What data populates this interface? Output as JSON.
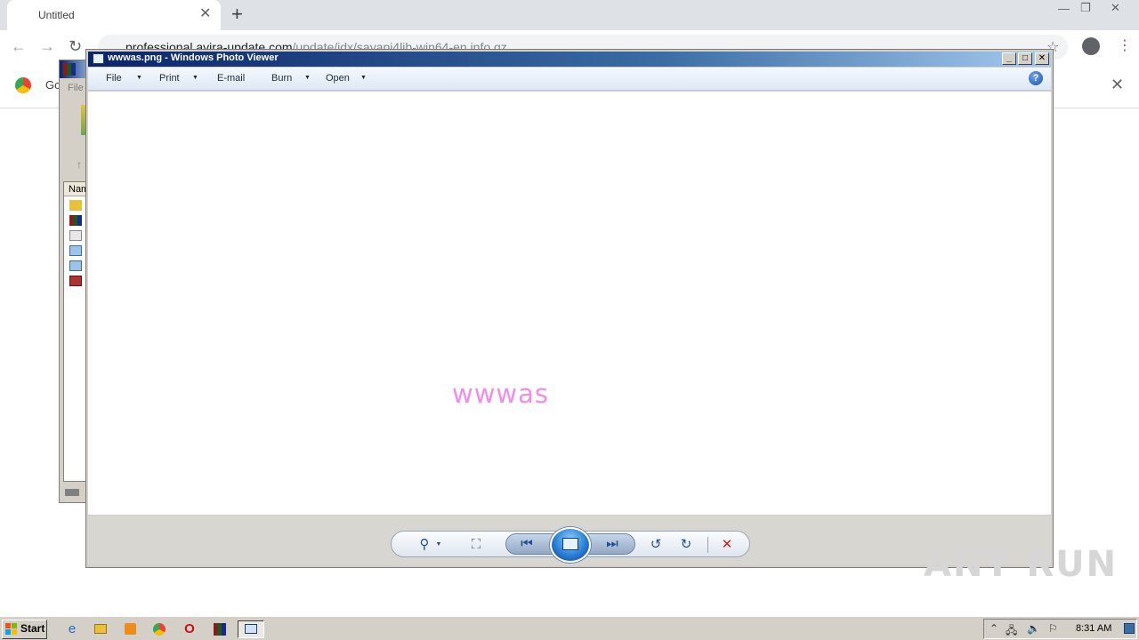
{
  "chrome": {
    "tab_title": "Untitled",
    "tab_close": "✕",
    "new_tab": "+",
    "minimize": "—",
    "restore": "❐",
    "close": "✕",
    "back": "←",
    "forward": "→",
    "reload": "↻",
    "url_host": "professional.avira-update.com",
    "url_path": "/update/idx/savapi4lib-win64-en.info.gz",
    "bookmark_star": "☆",
    "infobar_text": "Go",
    "infobar_close": "✕"
  },
  "winrar": {
    "menu_file": "File",
    "col_name": "Nam"
  },
  "photo_viewer": {
    "title": "wwwas.png - Windows Photo Viewer",
    "btn_minimize": "_",
    "btn_maximize": "□",
    "btn_close": "✕",
    "menu": {
      "file": "File",
      "print": "Print",
      "email": "E-mail",
      "burn": "Burn",
      "open": "Open"
    },
    "caret": "▼",
    "help": "?",
    "image_text": "wwwas",
    "controls": {
      "zoom": "⚲",
      "fit": "⛶",
      "prev": "⏮",
      "next": "⏭",
      "rotate_ccw": "↺",
      "rotate_cw": "↻",
      "delete": "✕"
    },
    "delete_color": "#d11a1a"
  },
  "watermark": "ANY RUN",
  "taskbar": {
    "start_label": "Start",
    "clock": "8:31 AM",
    "tray_up": "⌃"
  }
}
